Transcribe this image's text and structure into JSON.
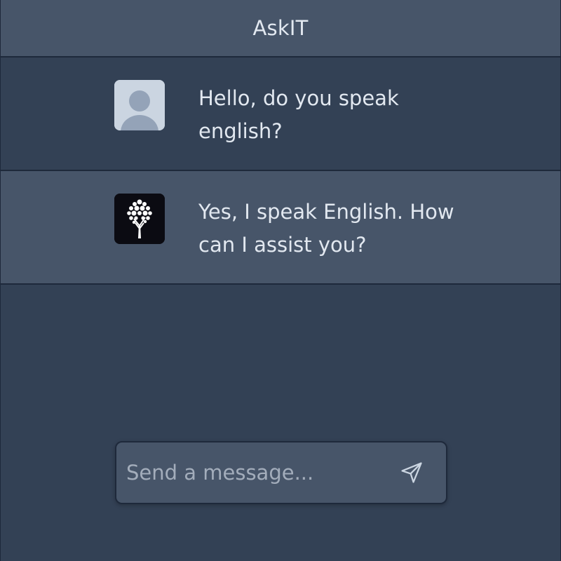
{
  "header": {
    "title": "AskIT"
  },
  "messages": [
    {
      "role": "user",
      "avatar_icon": "user-avatar-icon",
      "text": "Hello, do you speak english?"
    },
    {
      "role": "assistant",
      "avatar_icon": "tree-logo-icon",
      "text": "Yes, I speak English. How can I assist you?"
    }
  ],
  "composer": {
    "placeholder": "Send a message...",
    "value": "",
    "send_icon": "send-icon"
  },
  "colors": {
    "background": "#334155",
    "header_bg": "#475569",
    "assistant_row_bg": "#475569",
    "border": "#1e293b",
    "text": "#e2e8f0",
    "placeholder": "#a3adbb"
  }
}
